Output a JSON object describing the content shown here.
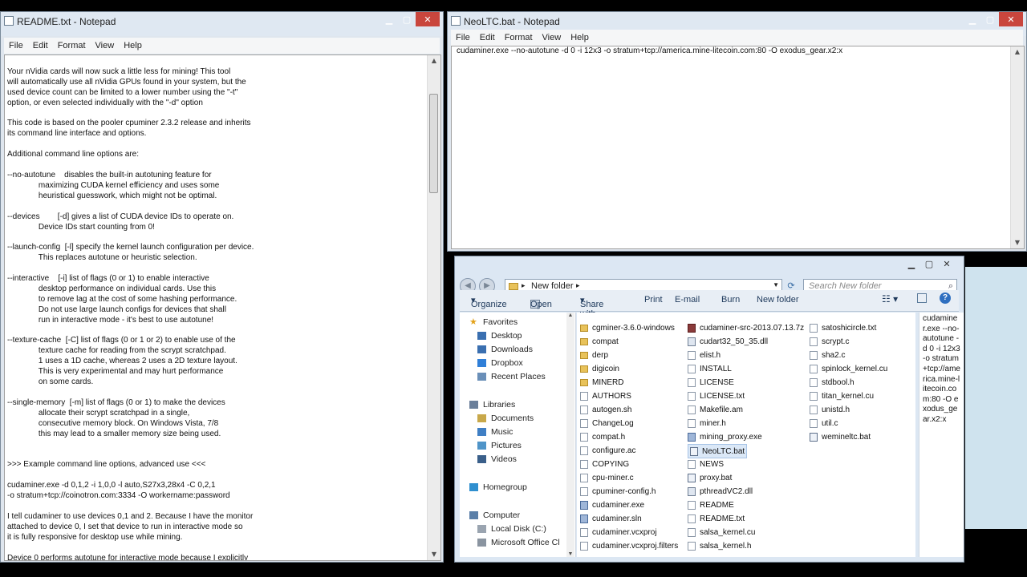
{
  "readme_window": {
    "title": "README.txt - Notepad",
    "menu": [
      "File",
      "Edit",
      "Format",
      "View",
      "Help"
    ],
    "lines": [
      "",
      "Your nVidia cards will now suck a little less for mining! This tool",
      "will automatically use all nVidia GPUs found in your system, but the",
      "used device count can be limited to a lower number using the \"-t\"",
      "option, or even selected individually with the \"-d\" option",
      "",
      "This code is based on the pooler cpuminer 2.3.2 release and inherits",
      "its command line interface and options.",
      "",
      "Additional command line options are:",
      "",
      "--no-autotune    disables the built-in autotuning feature for",
      "              maximizing CUDA kernel efficiency and uses some",
      "              heuristical guesswork, which might not be optimal.",
      "",
      "--devices        [-d] gives a list of CUDA device IDs to operate on.",
      "              Device IDs start counting from 0!",
      "",
      "--launch-config  [-l] specify the kernel launch configuration per device.",
      "              This replaces autotune or heuristic selection.",
      "",
      "--interactive    [-i] list of flags (0 or 1) to enable interactive",
      "              desktop performance on individual cards. Use this",
      "              to remove lag at the cost of some hashing performance.",
      "              Do not use large launch configs for devices that shall",
      "              run in interactive mode - it's best to use autotune!",
      "",
      "--texture-cache  [-C] list of flags (0 or 1 or 2) to enable use of the",
      "              texture cache for reading from the scrypt scratchpad.",
      "              1 uses a 1D cache, whereas 2 uses a 2D texture layout.",
      "              This is very experimental and may hurt performance",
      "              on some cards.",
      "",
      "--single-memory  [-m] list of flags (0 or 1) to make the devices",
      "              allocate their scrypt scratchpad in a single,",
      "              consecutive memory block. On Windows Vista, 7/8",
      "              this may lead to a smaller memory size being used.",
      "",
      "",
      ">>> Example command line options, advanced use <<<",
      "",
      "cudaminer.exe -d 0,1,2 -i 1,0,0 -l auto,S27x3,28x4 -C 0,2,1",
      "-o stratum+tcp://coinotron.com:3334 -O workername:password",
      "",
      "I tell cudaminer to use devices 0,1 and 2. Because I have the monitor",
      "attached to device 0, I set that device to run in interactive mode so",
      "it is fully responsive for desktop use while mining.",
      "",
      "Device 0 performs autotune for interactive mode because I explicitly"
    ]
  },
  "bat_window": {
    "title": "NeoLTC.bat - Notepad",
    "menu": [
      "File",
      "Edit",
      "Format",
      "View",
      "Help"
    ],
    "content": "cudaminer.exe --no-autotune -d 0 -i 12x3 -o stratum+tcp://america.mine-litecoin.com:80 -O exodus_gear.x2:x"
  },
  "explorer": {
    "address": "New folder",
    "search_placeholder": "Search New folder",
    "toolbar": {
      "organize": "Organize",
      "open": "Open",
      "share_with": "Share with",
      "print": "Print",
      "email": "E-mail",
      "burn": "Burn",
      "new_folder": "New folder"
    },
    "nav": [
      {
        "label": "Favorites",
        "type": "star",
        "indent": 0
      },
      {
        "label": "Desktop",
        "type": "desk",
        "indent": 1
      },
      {
        "label": "Downloads",
        "type": "dl",
        "indent": 1
      },
      {
        "label": "Dropbox",
        "type": "dbx",
        "indent": 1
      },
      {
        "label": "Recent Places",
        "type": "rp",
        "indent": 1
      },
      {
        "label": "",
        "type": "gap",
        "indent": 0
      },
      {
        "label": "Libraries",
        "type": "lib",
        "indent": 0
      },
      {
        "label": "Documents",
        "type": "doc",
        "indent": 1
      },
      {
        "label": "Music",
        "type": "mus",
        "indent": 1
      },
      {
        "label": "Pictures",
        "type": "pic",
        "indent": 1
      },
      {
        "label": "Videos",
        "type": "vid",
        "indent": 1
      },
      {
        "label": "",
        "type": "gap",
        "indent": 0
      },
      {
        "label": "Homegroup",
        "type": "hg",
        "indent": 0
      },
      {
        "label": "",
        "type": "gap",
        "indent": 0
      },
      {
        "label": "Computer",
        "type": "pc",
        "indent": 0
      },
      {
        "label": "Local Disk (C:)",
        "type": "disk",
        "indent": 1
      },
      {
        "label": "Microsoft Office Cl",
        "type": "disk2",
        "indent": 1
      }
    ],
    "files_col1": [
      {
        "name": "cgminer-3.6.0-windows",
        "kind": "folder"
      },
      {
        "name": "compat",
        "kind": "folder"
      },
      {
        "name": "derp",
        "kind": "folder"
      },
      {
        "name": "digicoin",
        "kind": "folder"
      },
      {
        "name": "MINERD",
        "kind": "folder"
      },
      {
        "name": "AUTHORS",
        "kind": "doc"
      },
      {
        "name": "autogen.sh",
        "kind": "doc"
      },
      {
        "name": "ChangeLog",
        "kind": "doc"
      },
      {
        "name": "compat.h",
        "kind": "doc"
      },
      {
        "name": "configure.ac",
        "kind": "doc"
      },
      {
        "name": "COPYING",
        "kind": "doc"
      },
      {
        "name": "cpu-miner.c",
        "kind": "doc"
      },
      {
        "name": "cpuminer-config.h",
        "kind": "doc"
      },
      {
        "name": "cudaminer.exe",
        "kind": "exe"
      },
      {
        "name": "cudaminer.sln",
        "kind": "exe"
      },
      {
        "name": "cudaminer.vcxproj",
        "kind": "doc"
      },
      {
        "name": "cudaminer.vcxproj.filters",
        "kind": "doc"
      }
    ],
    "files_col2": [
      {
        "name": "cudaminer-src-2013.07.13.7z",
        "kind": "zip"
      },
      {
        "name": "cudart32_50_35.dll",
        "kind": "dll"
      },
      {
        "name": "elist.h",
        "kind": "doc"
      },
      {
        "name": "INSTALL",
        "kind": "doc"
      },
      {
        "name": "LICENSE",
        "kind": "doc"
      },
      {
        "name": "LICENSE.txt",
        "kind": "doc"
      },
      {
        "name": "Makefile.am",
        "kind": "doc"
      },
      {
        "name": "miner.h",
        "kind": "doc"
      },
      {
        "name": "mining_proxy.exe",
        "kind": "exe"
      },
      {
        "name": "NeoLTC.bat",
        "kind": "bat"
      },
      {
        "name": "NEWS",
        "kind": "doc"
      },
      {
        "name": "proxy.bat",
        "kind": "bat"
      },
      {
        "name": "pthreadVC2.dll",
        "kind": "dll"
      },
      {
        "name": "README",
        "kind": "doc"
      },
      {
        "name": "README.txt",
        "kind": "doc"
      },
      {
        "name": "salsa_kernel.cu",
        "kind": "doc"
      },
      {
        "name": "salsa_kernel.h",
        "kind": "doc"
      }
    ],
    "files_col3": [
      {
        "name": "satoshicircle.txt",
        "kind": "doc"
      },
      {
        "name": "scrypt.c",
        "kind": "doc"
      },
      {
        "name": "sha2.c",
        "kind": "doc"
      },
      {
        "name": "spinlock_kernel.cu",
        "kind": "doc"
      },
      {
        "name": "stdbool.h",
        "kind": "doc"
      },
      {
        "name": "titan_kernel.cu",
        "kind": "doc"
      },
      {
        "name": "unistd.h",
        "kind": "doc"
      },
      {
        "name": "util.c",
        "kind": "doc"
      },
      {
        "name": "wemineltc.bat",
        "kind": "bat"
      }
    ],
    "selected": "NeoLTC.bat",
    "preview_text": "cudaminer.exe --no-autotune -d 0 -i 12x3 -o stratum+tcp://america.mine-litecoin.com:80 -O exodus_gear.x2:x"
  }
}
